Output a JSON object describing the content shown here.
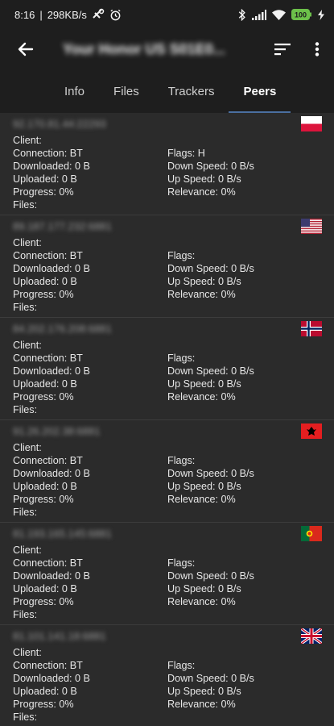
{
  "status_bar": {
    "time": "8:16",
    "speed": "298KB/s",
    "battery": "100"
  },
  "app_bar": {
    "title": "Your Honor US S01E0...",
    "back_icon": "arrow-back-icon",
    "sort_icon": "sort-icon",
    "menu_icon": "more-vert-icon"
  },
  "tabs": [
    {
      "label": "Info"
    },
    {
      "label": "Files"
    },
    {
      "label": "Trackers"
    },
    {
      "label": "Peers",
      "active": true
    }
  ],
  "labels": {
    "client": "Client:",
    "connection": "Connection:",
    "downloaded": "Downloaded:",
    "uploaded": "Uploaded:",
    "progress": "Progress:",
    "files": "Files:",
    "flags": "Flags:",
    "down_speed": "Down Speed:",
    "up_speed": "Up Speed:",
    "relevance": "Relevance:"
  },
  "peers": [
    {
      "address": "92.170.81.44:22293",
      "country": "Poland",
      "client": "",
      "connection": "BT",
      "downloaded": "0 B",
      "uploaded": "0 B",
      "progress": "0%",
      "files": "",
      "flags": "H",
      "down_speed": "0 B/s",
      "up_speed": "0 B/s",
      "relevance": "0%"
    },
    {
      "address": "89.187.177.232:6881",
      "country": "United States",
      "client": "",
      "connection": "BT",
      "downloaded": "0 B",
      "uploaded": "0 B",
      "progress": "0%",
      "files": "",
      "flags": "",
      "down_speed": "0 B/s",
      "up_speed": "0 B/s",
      "relevance": "0%"
    },
    {
      "address": "84.202.176.208:6881",
      "country": "Norway",
      "client": "",
      "connection": "BT",
      "downloaded": "0 B",
      "uploaded": "0 B",
      "progress": "0%",
      "files": "",
      "flags": "",
      "down_speed": "0 B/s",
      "up_speed": "0 B/s",
      "relevance": "0%"
    },
    {
      "address": "91.26.202.38:6881",
      "country": "Albania",
      "client": "",
      "connection": "BT",
      "downloaded": "0 B",
      "uploaded": "0 B",
      "progress": "0%",
      "files": "",
      "flags": "",
      "down_speed": "0 B/s",
      "up_speed": "0 B/s",
      "relevance": "0%"
    },
    {
      "address": "81.193.165.145:6881",
      "country": "Portugal",
      "client": "",
      "connection": "BT",
      "downloaded": "0 B",
      "uploaded": "0 B",
      "progress": "0%",
      "files": "",
      "flags": "",
      "down_speed": "0 B/s",
      "up_speed": "0 B/s",
      "relevance": "0%"
    },
    {
      "address": "81.101.141.18:6881",
      "country": "United Kingdom",
      "client": "",
      "connection": "BT",
      "downloaded": "0 B",
      "uploaded": "0 B",
      "progress": "0%",
      "files": "",
      "flags": "",
      "down_speed": "0 B/s",
      "up_speed": "0 B/s",
      "relevance": "0%"
    }
  ]
}
